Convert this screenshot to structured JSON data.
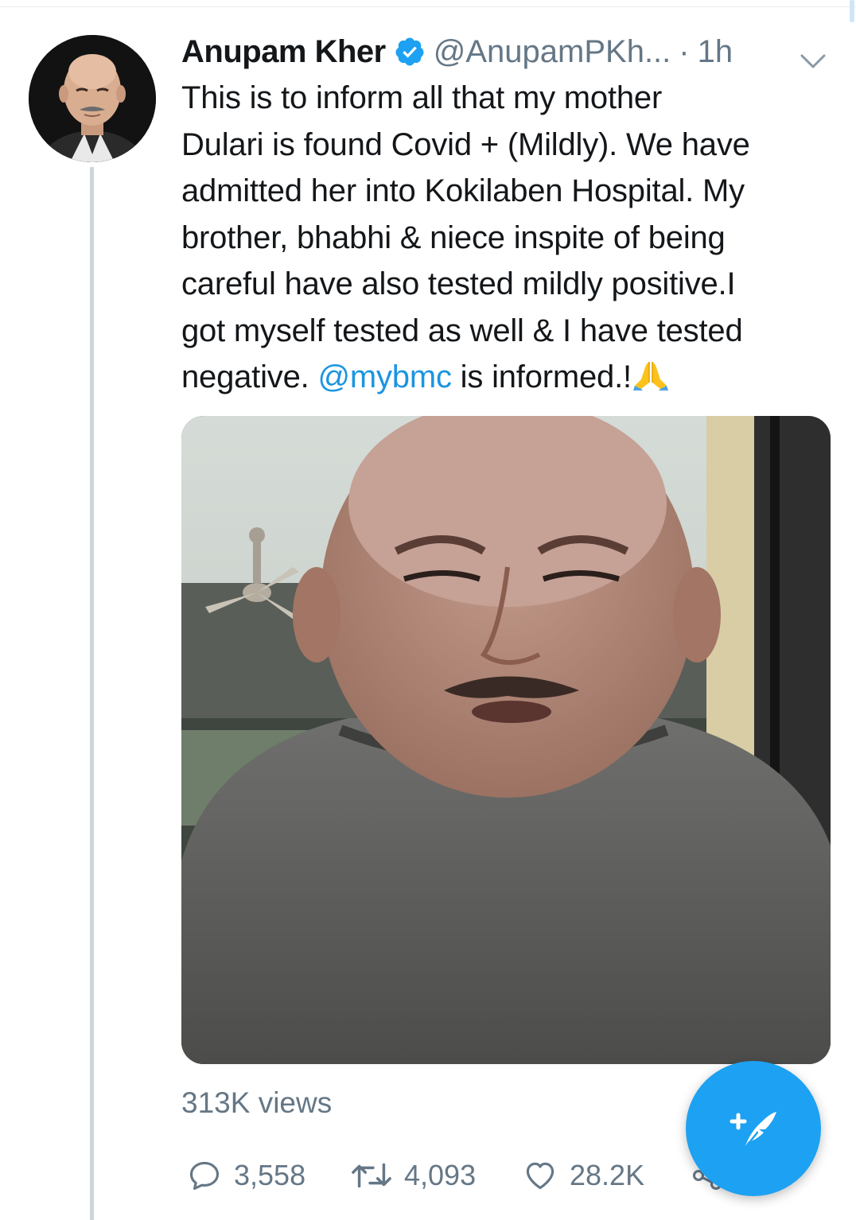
{
  "tweet": {
    "author": {
      "display_name": "Anupam Kher",
      "handle": "@AnupamPKh...",
      "verified": true,
      "avatar_icon": "profile-photo"
    },
    "separator": "·",
    "time": "1h",
    "text_lines": [
      "This is to inform all that my mother",
      "Dulari is found Covid + (Mildly). We have",
      "admitted her into Kokilaben Hospital. My",
      "brother, bhabhi & niece inspite of being",
      "careful have also tested mildly positive.I",
      "got myself tested as well & I have tested"
    ],
    "last_line_prefix": "negative. ",
    "mention": "@mybmc",
    "last_line_suffix": " is informed.!",
    "emoji": "folded-hands",
    "media": {
      "type": "video-thumbnail"
    },
    "views": "313K views",
    "actions": {
      "reply_count": "3,558",
      "retweet_count": "4,093",
      "like_count": "28.2K"
    }
  },
  "fab": {
    "icon": "compose-tweet-icon"
  },
  "colors": {
    "accent": "#1da1f2",
    "mention": "#1b95e0",
    "secondary_text": "#657786",
    "primary_text": "#14171a",
    "thread_line": "#ccd6dd"
  }
}
